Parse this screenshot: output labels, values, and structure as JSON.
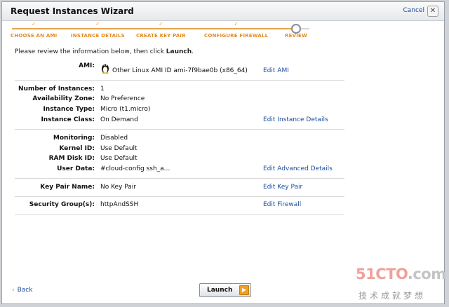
{
  "window": {
    "title": "Request Instances Wizard",
    "cancel_label": "Cancel"
  },
  "steps": [
    {
      "label": "CHOOSE AN AMI",
      "status": "done"
    },
    {
      "label": "INSTANCE DETAILS",
      "status": "done"
    },
    {
      "label": "CREATE KEY PAIR",
      "status": "done"
    },
    {
      "label": "CONFIGURE FIREWALL",
      "status": "done"
    },
    {
      "label": "REVIEW",
      "status": "current"
    }
  ],
  "intro": {
    "text": "Please review the information below, then click ",
    "emphasis": "Launch",
    "suffix": "."
  },
  "ami": {
    "label": "AMI:",
    "icon": "linux-penguin-icon",
    "value": "Other Linux AMI ID ami-7f9bae0b (x86_64)",
    "edit_label": "Edit AMI"
  },
  "instance_details": {
    "rows": [
      {
        "label": "Number of Instances:",
        "value": "1"
      },
      {
        "label": "Availability Zone:",
        "value": "No Preference"
      },
      {
        "label": "Instance Type:",
        "value": "Micro (t1.micro)"
      },
      {
        "label": "Instance Class:",
        "value": "On Demand"
      }
    ],
    "edit_label": "Edit Instance Details"
  },
  "advanced_details": {
    "rows": [
      {
        "label": "Monitoring:",
        "value": "Disabled"
      },
      {
        "label": "Kernel ID:",
        "value": "Use Default"
      },
      {
        "label": "RAM Disk ID:",
        "value": "Use Default"
      },
      {
        "label": "User Data:",
        "value": "#cloud-config ssh_a..."
      }
    ],
    "edit_label": "Edit Advanced Details"
  },
  "key_pair": {
    "label": "Key Pair Name:",
    "value": "No Key Pair",
    "edit_label": "Edit Key Pair"
  },
  "security": {
    "label": "Security Group(s):",
    "value": "httpAndSSH",
    "edit_label": "Edit Firewall"
  },
  "footer": {
    "back_label": "Back",
    "launch_label": "Launch"
  },
  "watermark": {
    "line1_a": "51CTO",
    "line1_b": ".com",
    "line2": "技术成就梦想"
  },
  "colors": {
    "accent_orange": "#e48a1f",
    "link_blue": "#1a4d9c"
  }
}
